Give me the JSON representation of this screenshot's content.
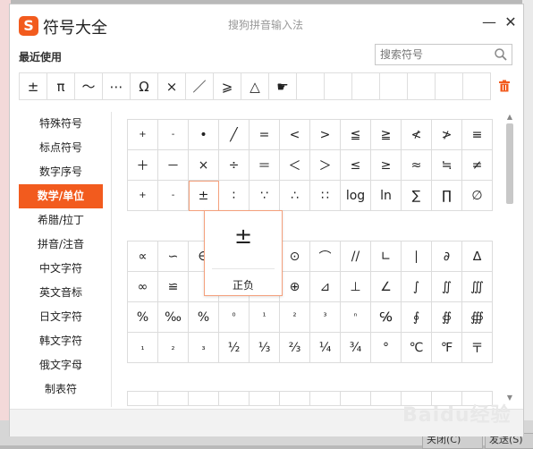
{
  "background": {
    "bottom_buttons": [
      "关闭(C)",
      "发送(S)"
    ],
    "watermark": "Baidu经验"
  },
  "window": {
    "logo_char": "S",
    "title": "符号大全",
    "subtitle": "搜狗拼音输入法",
    "min_symbol": "—",
    "close_symbol": "✕"
  },
  "recent": {
    "label": "最近使用",
    "symbols": [
      "±",
      "π",
      "～",
      "⋯",
      "Ω",
      "×",
      "／",
      "⩾",
      "△",
      "☛",
      "",
      "",
      "",
      "",
      "",
      "",
      ""
    ]
  },
  "search": {
    "placeholder": "搜索符号"
  },
  "categories": [
    {
      "label": "特殊符号",
      "active": false
    },
    {
      "label": "标点符号",
      "active": false
    },
    {
      "label": "数字序号",
      "active": false
    },
    {
      "label": "数学/单位",
      "active": true
    },
    {
      "label": "希腊/拉丁",
      "active": false
    },
    {
      "label": "拼音/注音",
      "active": false
    },
    {
      "label": "中文字符",
      "active": false
    },
    {
      "label": "英文音标",
      "active": false
    },
    {
      "label": "日文字符",
      "active": false
    },
    {
      "label": "韩文字符",
      "active": false
    },
    {
      "label": "俄文字母",
      "active": false
    },
    {
      "label": "制表符",
      "active": false
    }
  ],
  "grid_a": [
    "+",
    "-",
    "•",
    "╱",
    "=",
    "<",
    ">",
    "≦",
    "≧",
    "≮",
    "≯",
    "≡",
    "＋",
    "－",
    "×",
    "÷",
    "＝",
    "＜",
    "＞",
    "≤",
    "≥",
    "≈",
    "≒",
    "≠",
    "+",
    "-",
    "±",
    "∶",
    "∵",
    "∴",
    "∷",
    "log",
    "ln",
    "∑",
    "∏",
    "∅"
  ],
  "grid_b": [
    "∝",
    "∽",
    "∈",
    "",
    "",
    "⊙",
    "⌒",
    "//",
    "∟",
    "∣",
    "∂",
    "∆",
    "∞",
    "≌",
    "",
    "",
    "",
    "⊕",
    "⊿",
    "⊥",
    "∠",
    "∫",
    "∬",
    "∭",
    "%",
    "‰",
    "%",
    "⁰",
    "¹",
    "²",
    "³",
    "ⁿ",
    "℅",
    "∮",
    "∯",
    "∰",
    "₁",
    "₂",
    "₃",
    "½",
    "⅓",
    "⅔",
    "¼",
    "¾",
    "°",
    "℃",
    "℉",
    "〒"
  ],
  "grid_c": [
    "",
    "",
    "",
    "",
    "",
    "",
    "",
    "",
    "",
    "",
    "",
    ""
  ],
  "popup": {
    "symbol": "±",
    "label": "正负"
  },
  "colors": {
    "accent": "#f25b1e",
    "highlight_border": "#f4a07c"
  }
}
